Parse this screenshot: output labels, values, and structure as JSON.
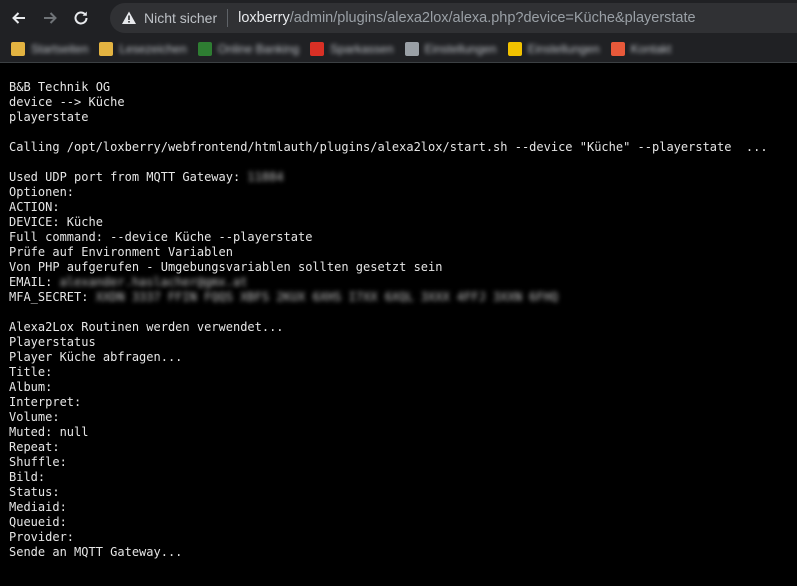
{
  "browser": {
    "security_label": "Nicht sicher",
    "url_host": "loxberry",
    "url_path": "/admin/plugins/alexa2lox/alexa.php?device=Küche&playerstate",
    "bookmarks": [
      {
        "label": "Startseiten",
        "color": "#e3b341"
      },
      {
        "label": "Lesezeichen",
        "color": "#e3b341"
      },
      {
        "label": "Online Banking",
        "color": "#2e7d32"
      },
      {
        "label": "Sparkassen",
        "color": "#d93025"
      },
      {
        "label": "Einstellungen",
        "color": "#9aa0a6"
      },
      {
        "label": "Einstellungen",
        "color": "#f2c200"
      },
      {
        "label": "Kontakt",
        "color": "#e8593a"
      }
    ]
  },
  "terminal": {
    "lines": [
      "B&B Technik OG",
      "device --> Küche",
      "playerstate",
      "",
      "Calling /opt/loxberry/webfrontend/htmlauth/plugins/alexa2lox/start.sh --device \"Küche\" --playerstate  ...",
      "",
      "Used UDP port from MQTT Gateway: ",
      "Optionen:",
      "ACTION:",
      "DEVICE: Küche",
      "Full command: --device Küche --playerstate",
      "Prüfe auf Environment Variablen",
      "Von PHP aufgerufen - Umgebungsvariablen sollten gesetzt sein",
      "EMAIL: ",
      "MFA_SECRET: ",
      "",
      "Alexa2Lox Routinen werden verwendet...",
      "Playerstatus",
      "Player Küche abfragen...",
      "Title:",
      "Album:",
      "Interpret:",
      "Volume:",
      "Muted: null",
      "Repeat:",
      "Shuffle:",
      "Bild:",
      "Status:",
      "Mediaid:",
      "Queueid:",
      "Provider:",
      "Sende an MQTT Gateway..."
    ],
    "redacted": {
      "udp_port": "11884",
      "email": "alexander.haslacher@gmx.at",
      "mfa_secret": "XXDN 3337 FFIN FQQS XBFS 2KUX 6XHS I7XX 6XQL 3XXX 4FFJ 3XXN 6FHQ"
    }
  }
}
